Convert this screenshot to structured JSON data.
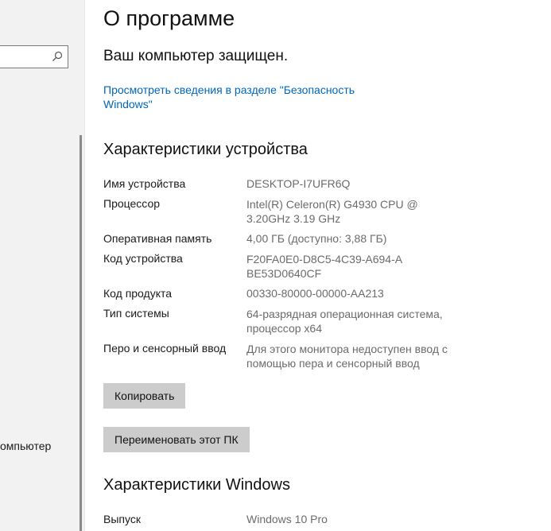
{
  "sidebar": {
    "search": {
      "placeholder": ""
    },
    "items": [
      {
        "label": "омпьютер"
      }
    ]
  },
  "main": {
    "title": "О программе",
    "protection_status": "Ваш компьютер защищен.",
    "security_link": "Просмотреть сведения в разделе \"Безопасность Windows\""
  },
  "device_specs": {
    "heading": "Характеристики устройства",
    "rows": [
      {
        "label": "Имя устройства",
        "value": "DESKTOP-I7UFR6Q"
      },
      {
        "label": "Процессор",
        "value": "Intel(R) Celeron(R) G4930 CPU @ 3.20GHz 3.19 GHz"
      },
      {
        "label": "Оперативная память",
        "value": "4,00 ГБ (доступно: 3,88 ГБ)"
      },
      {
        "label": "Код устройства",
        "value": "F20FA0E0-D8C5-4C39-A694-ABE53D0640CF"
      },
      {
        "label": "Код продукта",
        "value": "00330-80000-00000-AA213"
      },
      {
        "label": "Тип системы",
        "value": "64-разрядная операционная система, процессор x64"
      },
      {
        "label": "Перо и сенсорный ввод",
        "value": "Для этого монитора недоступен ввод с помощью пера и сенсорный ввод"
      }
    ],
    "copy_button": "Копировать",
    "rename_button": "Переименовать этот ПК"
  },
  "windows_specs": {
    "heading": "Характеристики Windows",
    "rows": [
      {
        "label": "Выпуск",
        "value": "Windows 10 Pro"
      }
    ]
  },
  "colors": {
    "link": "#0067b8",
    "sidebar_bg": "#f2f2f2",
    "button_bg": "#cccccc",
    "value_text": "#6b6b6b"
  }
}
